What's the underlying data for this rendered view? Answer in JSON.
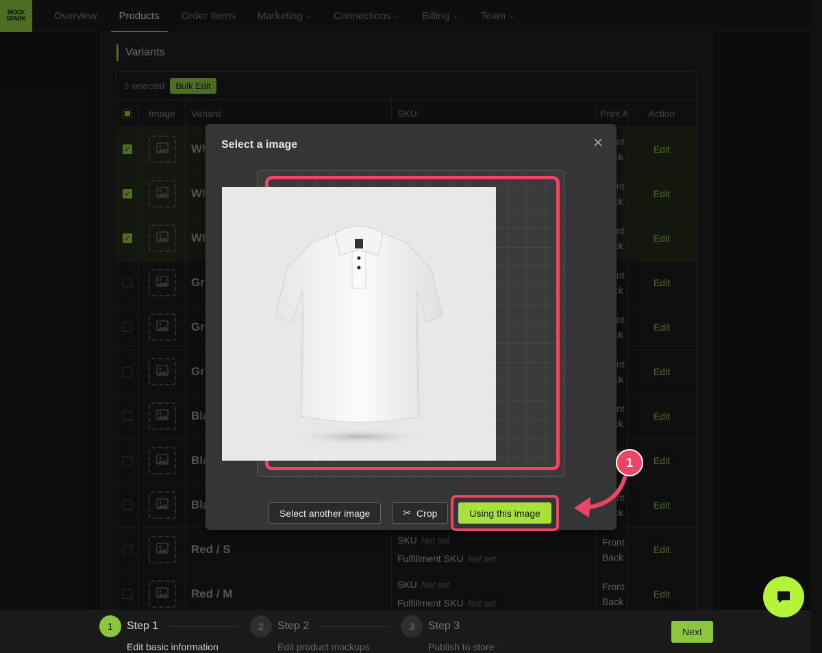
{
  "nav": {
    "logo_line1": "MOCK",
    "logo_line2": "SPARK",
    "items": [
      {
        "label": "Overview",
        "active": false,
        "dropdown": false
      },
      {
        "label": "Products",
        "active": true,
        "dropdown": false
      },
      {
        "label": "Order Items",
        "active": false,
        "dropdown": false
      },
      {
        "label": "Marketing",
        "active": false,
        "dropdown": true
      },
      {
        "label": "Connections",
        "active": false,
        "dropdown": true
      },
      {
        "label": "Billing",
        "active": false,
        "dropdown": true
      },
      {
        "label": "Team",
        "active": false,
        "dropdown": true
      }
    ]
  },
  "variants": {
    "title": "Variants",
    "selected_text": "3 selected",
    "bulk_edit_label": "Bulk Edit",
    "columns": {
      "image": "Image",
      "variant": "Variant",
      "sku": "SKU",
      "print": "Print A",
      "action": "Action"
    },
    "rows": [
      {
        "name": "Wh",
        "selected": true,
        "print": [
          "Front",
          "Back s"
        ],
        "action": "Edit"
      },
      {
        "name": "Wh",
        "selected": true,
        "print": [
          "Front",
          "Back s"
        ],
        "action": "Edit"
      },
      {
        "name": "Wh",
        "selected": true,
        "print": [
          "Front",
          "Back s"
        ],
        "action": "Edit"
      },
      {
        "name": "Gr",
        "selected": false,
        "print": [
          "Front",
          "Back s"
        ],
        "action": "Edit"
      },
      {
        "name": "Gr",
        "selected": false,
        "print": [
          "Front",
          "Back s"
        ],
        "action": "Edit"
      },
      {
        "name": "Gr",
        "selected": false,
        "print": [
          "Front",
          "Back s"
        ],
        "action": "Edit"
      },
      {
        "name": "Bla",
        "selected": false,
        "print": [
          "Front",
          "Back s"
        ],
        "action": "Edit"
      },
      {
        "name": "Bla",
        "selected": false,
        "print": [
          "Front",
          "Back s"
        ],
        "action": "Edit"
      },
      {
        "name": "Bla",
        "selected": false,
        "print": [
          "Front",
          "Back s"
        ],
        "action": "Edit"
      },
      {
        "name": "Red / S",
        "selected": false,
        "sku_label": "SKU",
        "sku_value": "Not set",
        "fsku_label": "Fulfillment SKU",
        "fsku_value": "Not set",
        "print": [
          "Front",
          "Back s"
        ],
        "action": "Edit"
      },
      {
        "name": "Red / M",
        "selected": false,
        "sku_label": "SKU",
        "sku_value": "Not set",
        "fsku_label": "Fulfillment SKU",
        "fsku_value": "Not set",
        "print": [
          "Front",
          "Back s"
        ],
        "action": "Edit"
      }
    ]
  },
  "modal": {
    "title": "Select a image",
    "close_icon": "×",
    "select_another_label": "Select another image",
    "crop_label": "Crop",
    "use_label": "Using this image"
  },
  "callout": {
    "number": "1"
  },
  "steps": [
    {
      "num": "1",
      "title": "Step 1",
      "desc": "Edit basic information",
      "active": true
    },
    {
      "num": "2",
      "title": "Step 2",
      "desc": "Edit product mockups",
      "active": false
    },
    {
      "num": "3",
      "title": "Step 3",
      "desc": "Publish to store",
      "active": false
    }
  ],
  "next_label": "Next",
  "colors": {
    "accent": "#8cc63f",
    "highlight": "#ee4466",
    "primary_button": "#a9e03a"
  }
}
